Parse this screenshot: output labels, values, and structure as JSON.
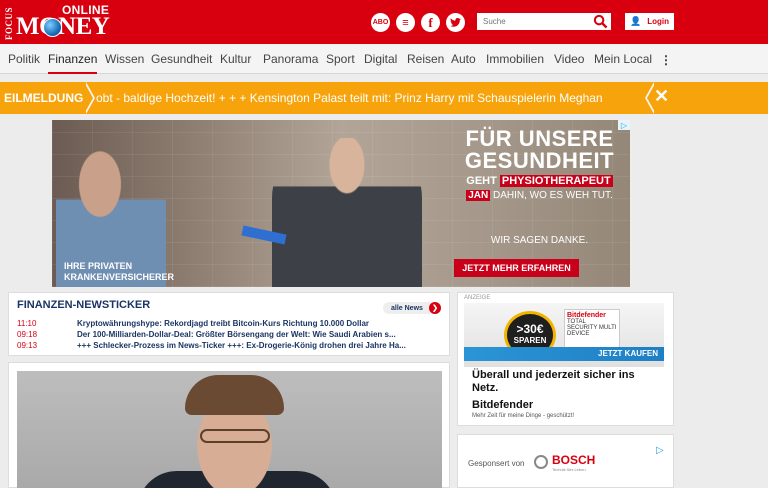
{
  "header": {
    "logo_small": "FOCUS",
    "logo_top": "ONLINE",
    "logo_main": "MONEY",
    "abo": "ABO",
    "search_placeholder": "Suche",
    "login": "Login"
  },
  "nav": {
    "items": [
      "Politik",
      "Finanzen",
      "Wissen",
      "Gesundheit",
      "Kultur",
      "Panorama",
      "Sport",
      "Digital",
      "Reisen",
      "Auto",
      "Immobilien",
      "Video",
      "Mein Local"
    ],
    "active": "Finanzen",
    "more": "⋮"
  },
  "breaking": {
    "tag": "EILMELDUNG",
    "ticker": "obt - baldige Hochzeit!   + + +   Kensington Palast teilt mit: Prinz Harry mit Schauspielerin Meghan"
  },
  "ad": {
    "headline": "FÜR UNSERE GESUNDHEIT",
    "line1_pre": "GEHT",
    "line1_hl": "PHYSIOTHERAPEUT",
    "line2_hl": "JAN",
    "line2_post": "DAHIN, WO ES WEH TUT.",
    "line3": "WIR SAGEN DANKE.",
    "cta": "JETZT MEHR ERFAHREN",
    "brand": "IHRE PRIVATEN KRANKENVERSICHERER",
    "adchoice": "▷"
  },
  "newsticker": {
    "title": "FINANZEN-NEWSTICKER",
    "all_news": "alle News",
    "items": [
      {
        "time": "11:10",
        "text": "Kryptowährungshype: Rekordjagd treibt Bitcoin-Kurs Richtung 10.000 Dollar"
      },
      {
        "time": "09:18",
        "text": "Der 100-Milliarden-Dollar-Deal: Größter Börsengang der Welt: Wie Saudi Arabien s..."
      },
      {
        "time": "09:13",
        "text": "+++ Schlecker-Prozess im News-Ticker +++: Ex-Drogerie-König drohen drei Jahre Ha..."
      }
    ]
  },
  "right_ad": {
    "label": "ANZEIGE",
    "badge_big": ">30€",
    "badge_small": "SPAREN",
    "box_brand": "Bitdefender",
    "box_text": "TOTAL SECURITY MULTI DEVICE",
    "kaufen": "JETZT KAUFEN",
    "tagline": "Überall und jederzeit sicher ins Netz.",
    "brand": "Bitdefender",
    "small": "Mehr Zeit für meine Dinge - geschützt!"
  },
  "right_ad2": {
    "sponsored": "Gesponsert von",
    "brand": "BOSCH",
    "brand_sub": "Technik fürs Leben"
  }
}
